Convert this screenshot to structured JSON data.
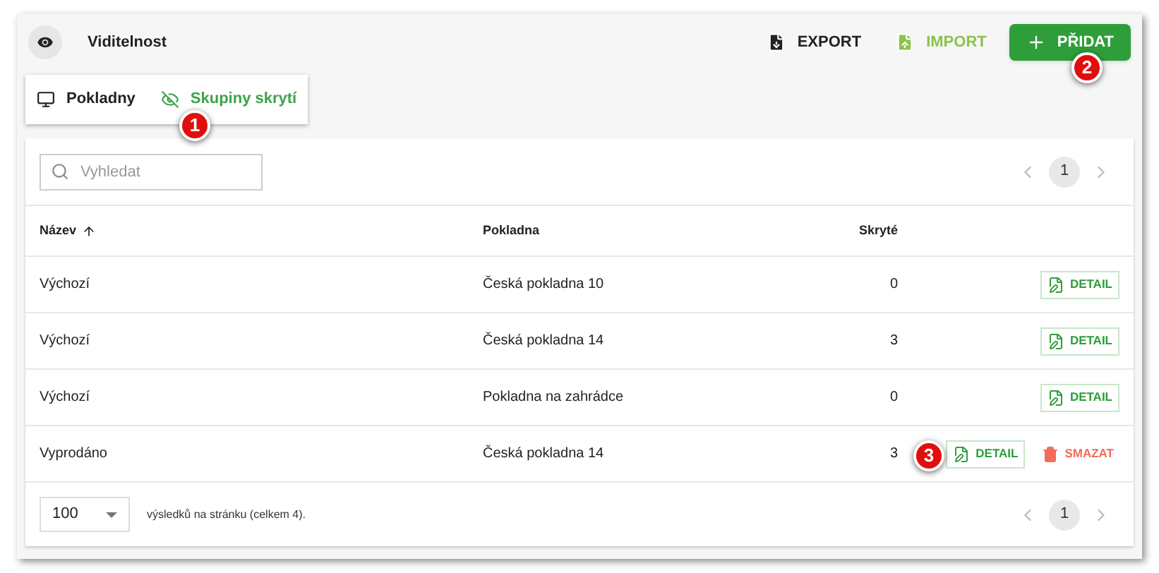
{
  "header": {
    "title": "Viditelnost",
    "actions": [
      {
        "label": "EXPORT",
        "kind": "export"
      },
      {
        "label": "IMPORT",
        "kind": "import"
      },
      {
        "label": "PŘIDAT",
        "kind": "add"
      }
    ]
  },
  "tabs": [
    {
      "label": "Pokladny",
      "selected": false
    },
    {
      "label": "Skupiny skrytí",
      "selected": true
    }
  ],
  "search": {
    "placeholder": "Vyhledat"
  },
  "pagination_top": {
    "pages": [
      {
        "label": "1",
        "selected": true
      }
    ]
  },
  "table": {
    "columns": [
      {
        "label": "Název",
        "sorted": true
      },
      {
        "label": "Pokladna"
      },
      {
        "label": "Skryté"
      }
    ],
    "rows": [
      {
        "name": "Výchozí",
        "pokladna": "Česká pokladna 10",
        "skryte": "0",
        "actions": [
          {
            "label": "DETAIL",
            "kind": "detail"
          }
        ]
      },
      {
        "name": "Výchozí",
        "pokladna": "Česká pokladna 14",
        "skryte": "3",
        "actions": [
          {
            "label": "DETAIL",
            "kind": "detail"
          }
        ]
      },
      {
        "name": "Výchozí",
        "pokladna": "Pokladna na zahrádce",
        "skryte": "0",
        "actions": [
          {
            "label": "DETAIL",
            "kind": "detail"
          }
        ]
      },
      {
        "name": "Vyprodáno",
        "pokladna": "Česká pokladna 14",
        "skryte": "3",
        "actions": [
          {
            "label": "DETAIL",
            "kind": "detail"
          },
          {
            "label": "SMAZAT",
            "kind": "delete"
          }
        ]
      }
    ]
  },
  "footer": {
    "page_size": "100",
    "summary": "výsledků na stránku (celkem 4).",
    "pages": [
      {
        "label": "1",
        "selected": true
      }
    ]
  },
  "callouts": [
    {
      "label": "1"
    },
    {
      "label": "2"
    },
    {
      "label": "3"
    }
  ]
}
